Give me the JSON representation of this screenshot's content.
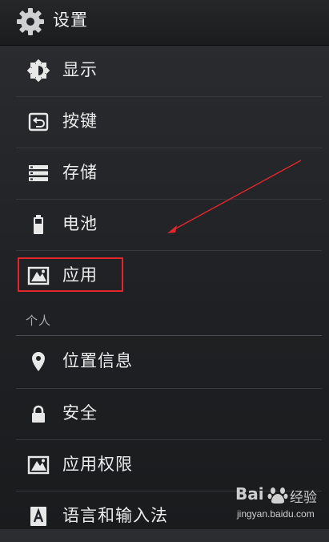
{
  "action_bar": {
    "title": "设置",
    "icon": "gear-icon"
  },
  "items_top": [
    {
      "label": "显示",
      "icon": "brightness-icon"
    },
    {
      "label": "按键",
      "icon": "back-key-icon"
    },
    {
      "label": "存储",
      "icon": "storage-icon"
    },
    {
      "label": "电池",
      "icon": "battery-icon"
    },
    {
      "label": "应用",
      "icon": "apps-icon"
    }
  ],
  "section_personal": {
    "label": "个人"
  },
  "items_personal": [
    {
      "label": "位置信息",
      "icon": "location-pin-icon"
    },
    {
      "label": "安全",
      "icon": "lock-icon"
    },
    {
      "label": "应用权限",
      "icon": "app-permissions-icon"
    },
    {
      "label": "语言和输入法",
      "icon": "language-keyboard-icon"
    }
  ],
  "annotation": {
    "highlight_color": "#e3262b",
    "arrow_color": "#e3262b"
  },
  "watermark": {
    "brand": "Bai",
    "brand_suffix": "经验",
    "url": "jingyan.baidu.com"
  }
}
